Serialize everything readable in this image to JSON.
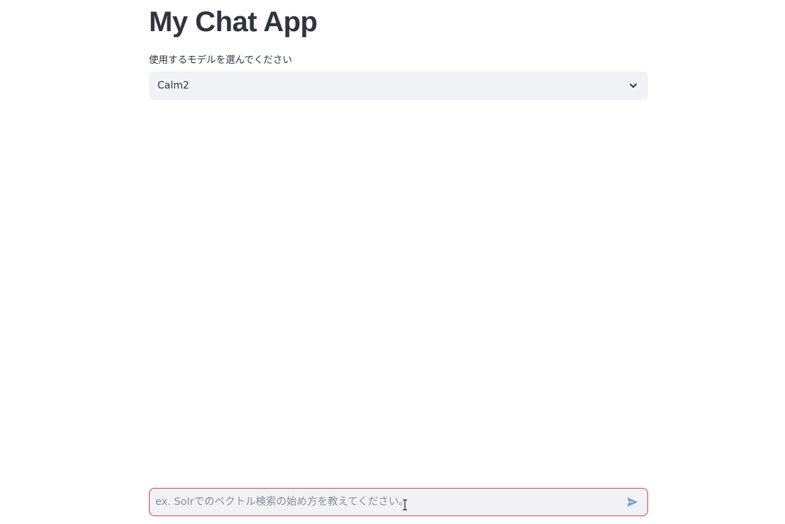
{
  "header": {
    "title": "My Chat App"
  },
  "model_select": {
    "label": "使用するモデルを選んでください",
    "selected_value": "Calm2"
  },
  "chat_input": {
    "placeholder": "ex. Solrでのベクトル検索の始め方を教えてください。",
    "value": ""
  },
  "icons": {
    "select_chevron": "chevron-down-icon",
    "send": "send-icon"
  },
  "colors": {
    "text": "#31333f",
    "input_background": "#f0f2f6",
    "input_focus_border": "#e0403d",
    "send_icon": "#7f9cc9",
    "placeholder": "#8b8e98"
  }
}
